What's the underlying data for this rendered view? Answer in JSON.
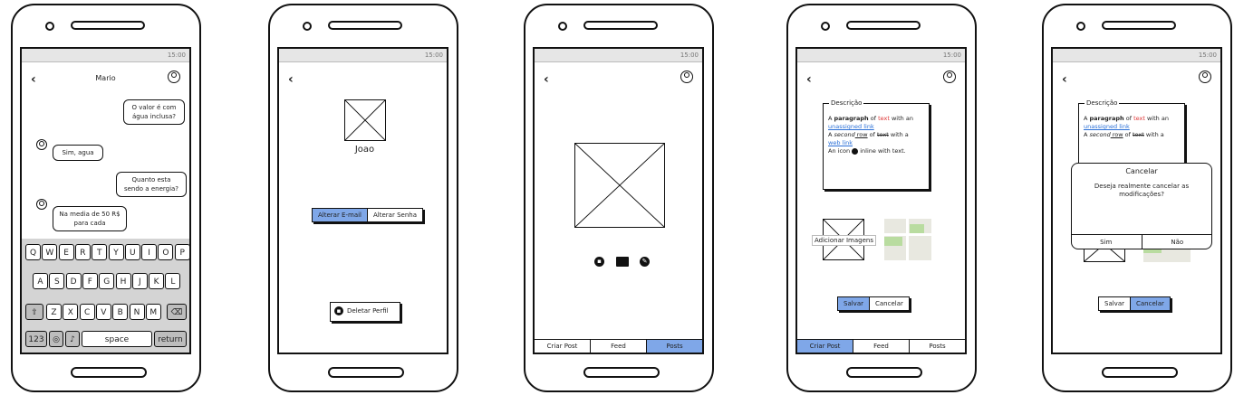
{
  "status_time": "15:00",
  "phone1": {
    "title": "Mario",
    "messages": [
      {
        "side": "right",
        "text": "O valor é com água inclusa?"
      },
      {
        "side": "left",
        "text": "Sim, agua"
      },
      {
        "side": "right",
        "text": "Quanto esta sendo a energia?"
      },
      {
        "side": "left",
        "text": "Na media de 50 R$ para cada"
      }
    ],
    "keyboard": {
      "row1": [
        "Q",
        "W",
        "E",
        "R",
        "T",
        "Y",
        "U",
        "I",
        "O",
        "P"
      ],
      "row2": [
        "A",
        "S",
        "D",
        "F",
        "G",
        "H",
        "J",
        "K",
        "L"
      ],
      "row3": [
        "Z",
        "X",
        "C",
        "V",
        "B",
        "N",
        "M"
      ],
      "num_label": "123",
      "space_label": "space",
      "return_label": "return"
    }
  },
  "phone2": {
    "name": "Joao",
    "seg_active": "Alterar E-mail",
    "seg_other": "Alterar Senha",
    "delete_label": "Deletar Perfil"
  },
  "phone3": {
    "tabs": [
      "Criar Post",
      "Feed",
      "Posts"
    ],
    "active_tab": "Posts"
  },
  "phone4": {
    "legend": "Descrição",
    "para": {
      "a": "A ",
      "paragraph": "paragraph",
      "of": " of ",
      "text": "text",
      "with_an": " with an",
      "link1": "unassigned link",
      "b": "A ",
      "second": "second",
      "row": " row",
      "of2": " of ",
      "text2": "text",
      "with_a": " with a",
      "link2": "web link",
      "c": "An icon ",
      "d": " inline with text."
    },
    "add_images": "Adicionar Imagens",
    "save": "Salvar",
    "cancel": "Cancelar",
    "tabs": [
      "Criar Post",
      "Feed",
      "Posts"
    ],
    "active_tab": "Criar Post"
  },
  "phone5": {
    "modal_title": "Cancelar",
    "modal_msg": "Deseja realmente cancelar as modificações?",
    "yes": "Sim",
    "no": "Não",
    "save": "Salvar",
    "cancel": "Cancelar",
    "active_button": "Cancelar"
  },
  "colors": {
    "accent": "#7fa7e8",
    "link": "#2a6fd6",
    "red_text": "#d33333"
  }
}
